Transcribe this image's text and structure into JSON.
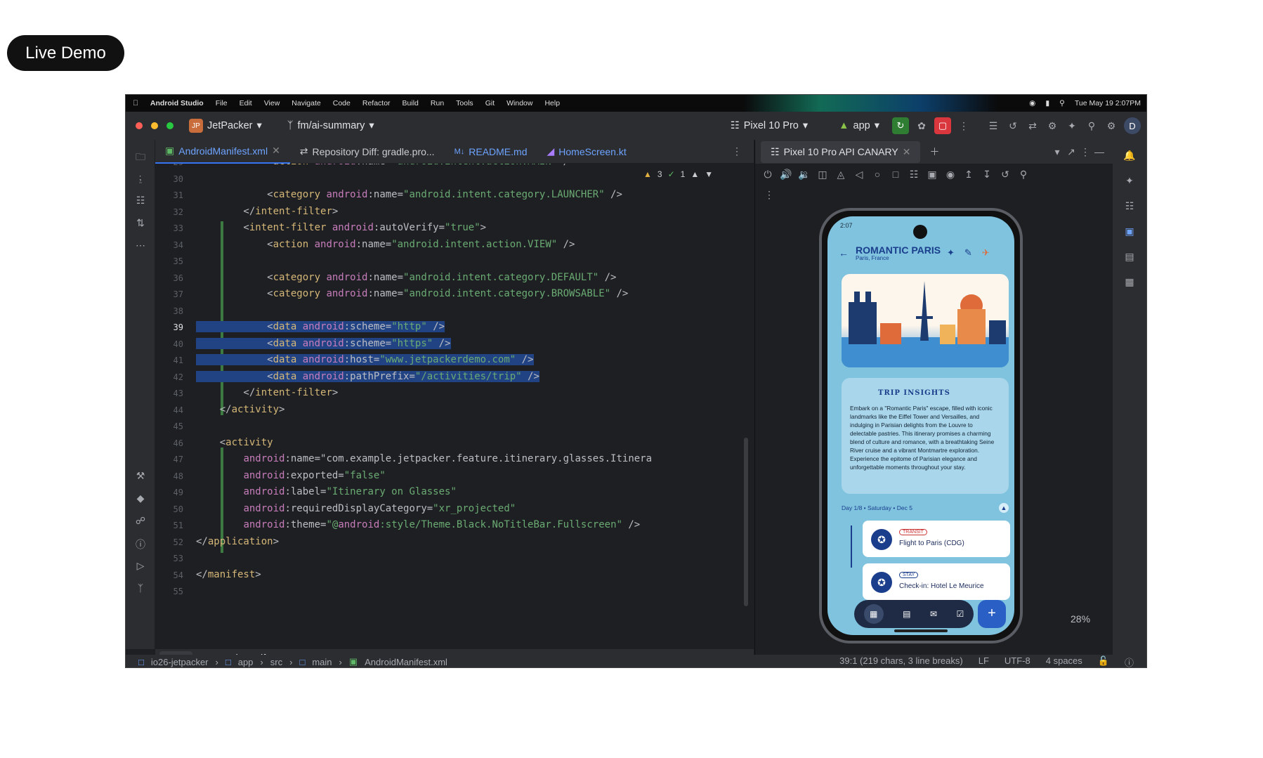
{
  "badge": "Live Demo",
  "macbar": {
    "app": "Android Studio",
    "menus": [
      "File",
      "Edit",
      "View",
      "Navigate",
      "Code",
      "Refactor",
      "Build",
      "Run",
      "Tools",
      "Git",
      "Window",
      "Help"
    ],
    "clock": "Tue May 19 2:07PM"
  },
  "toolbar": {
    "project_badge": "JP",
    "project": "JetPacker",
    "branch": "fm/ai-summary",
    "device": "Pixel 10 Pro",
    "config": "app",
    "avatar": "D"
  },
  "editor_tabs": [
    "AndroidManifest.xml",
    "Repository Diff: gradle.pro...",
    "README.md",
    "HomeScreen.kt"
  ],
  "inspection": {
    "warnings": "3",
    "checks": "1"
  },
  "code_lines": [
    {
      "n": "29",
      "t": "            <action android:name=\"android.intent.action.MAIN\" />"
    },
    {
      "n": "30",
      "t": ""
    },
    {
      "n": "31",
      "t": "            <category android:name=\"android.intent.category.LAUNCHER\" />"
    },
    {
      "n": "32",
      "t": "        </intent-filter>"
    },
    {
      "n": "33",
      "t": "        <intent-filter android:autoVerify=\"true\">"
    },
    {
      "n": "34",
      "t": "            <action android:name=\"android.intent.action.VIEW\" />"
    },
    {
      "n": "35",
      "t": ""
    },
    {
      "n": "36",
      "t": "            <category android:name=\"android.intent.category.DEFAULT\" />"
    },
    {
      "n": "37",
      "t": "            <category android:name=\"android.intent.category.BROWSABLE\" />"
    },
    {
      "n": "38",
      "t": ""
    },
    {
      "n": "39",
      "t": "            <data android:scheme=\"http\" />"
    },
    {
      "n": "40",
      "t": "            <data android:scheme=\"https\" />"
    },
    {
      "n": "41",
      "t": "            <data android:host=\"www.jetpackerdemo.com\" />"
    },
    {
      "n": "42",
      "t": "            <data android:pathPrefix=\"/activities/trip\" />"
    },
    {
      "n": "43",
      "t": "        </intent-filter>"
    },
    {
      "n": "44",
      "t": "    </activity>"
    },
    {
      "n": "45",
      "t": ""
    },
    {
      "n": "46",
      "t": "    <activity"
    },
    {
      "n": "47",
      "t": "        android:name=\"com.example.jetpacker.feature.itinerary.glasses.Itinera"
    },
    {
      "n": "48",
      "t": "        android:exported=\"false\""
    },
    {
      "n": "49",
      "t": "        android:label=\"Itinerary on Glasses\""
    },
    {
      "n": "50",
      "t": "        android:requiredDisplayCategory=\"xr_projected\""
    },
    {
      "n": "51",
      "t": "        android:theme=\"@android:style/Theme.Black.NoTitleBar.Fullscreen\" />"
    },
    {
      "n": "52",
      "t": "</application>"
    },
    {
      "n": "53",
      "t": ""
    },
    {
      "n": "54",
      "t": "</manifest>"
    },
    {
      "n": "55",
      "t": ""
    }
  ],
  "bottom_tabs": {
    "text": "Text",
    "merged": "Merged Manifest"
  },
  "breadcrumb": [
    "io26-jetpacker",
    "app",
    "src",
    "main",
    "AndroidManifest.xml"
  ],
  "status": {
    "pos": "39:1 (219 chars, 3 line breaks)",
    "lf": "LF",
    "enc": "UTF-8",
    "indent": "4 spaces"
  },
  "emulator": {
    "tab": "Pixel 10 Pro API CANARY",
    "zoom": "28%"
  },
  "phone": {
    "time": "2:07",
    "title": "ROMANTIC PARIS",
    "subtitle": "Paris, France",
    "insights_title": "TRIP INSIGHTS",
    "insights_body": "Embark on a \"Romantic Paris\" escape, filled with iconic landmarks like the Eiffel Tower and Versailles, and indulging in Parisian delights from the Louvre to delectable pastries. This itinerary promises a charming blend of culture and romance, with a breathtaking Seine River cruise and a vibrant Montmartre exploration. Experience the epitome of Parisian elegance and unforgettable moments throughout your stay.",
    "day": "Day 1/8 • Saturday • Dec 5",
    "events": [
      {
        "badge": "TRANSIT",
        "name": "Flight to Paris (CDG)"
      },
      {
        "badge": "STAY",
        "name": "Check-in: Hotel Le Meurice"
      }
    ]
  }
}
